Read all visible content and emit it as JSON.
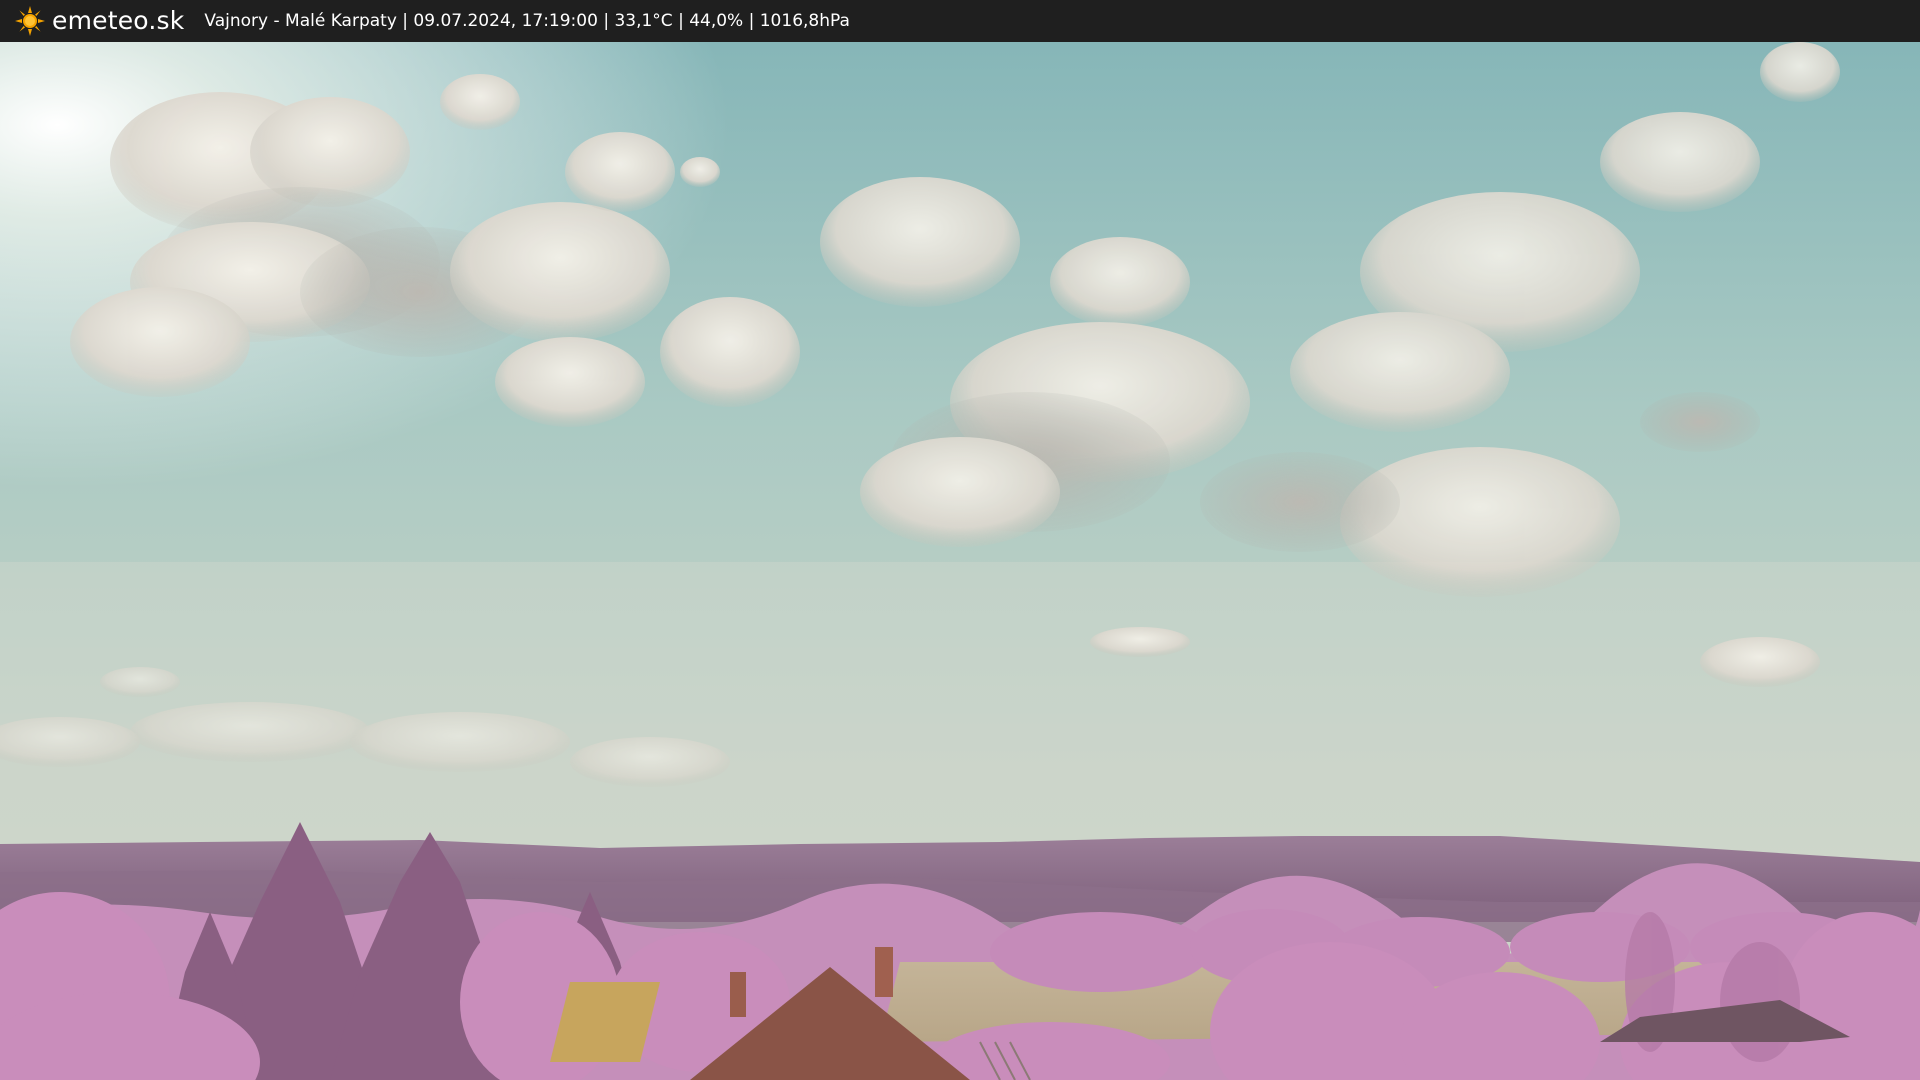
{
  "topbar": {
    "brand": "emeteo.sk",
    "caption": "Vajnory - Malé Karpaty | 09.07.2024, 17:19:00 | 33,1°C | 44,0% | 1016,8hPa",
    "logo_icon": "sun-icon",
    "logo_color": "#f5a300"
  },
  "scene": {
    "sky_color": "#9fc7c4",
    "hills_color": "#8a6a86",
    "foliage_color": "#c88ab8",
    "field_color": "#c9b79a"
  }
}
